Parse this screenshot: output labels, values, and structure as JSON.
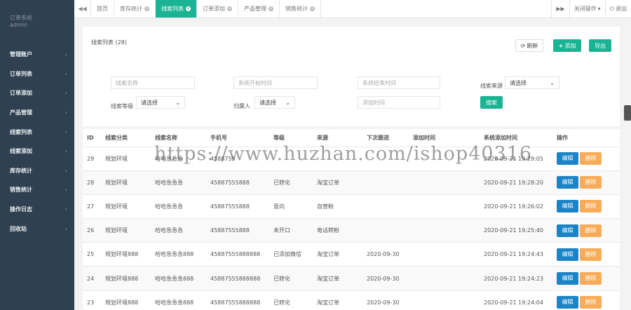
{
  "sidebar": {
    "brand_title": "订单系统",
    "brand_user": "admin",
    "items": [
      {
        "label": "管理账户"
      },
      {
        "label": "订单列表"
      },
      {
        "label": "订单添加"
      },
      {
        "label": "产品管理"
      },
      {
        "label": "线索列表"
      },
      {
        "label": "线索添加"
      },
      {
        "label": "库存统计"
      },
      {
        "label": "销售统计"
      },
      {
        "label": "操作日志"
      },
      {
        "label": "回收站"
      }
    ],
    "chevron": "‹"
  },
  "topbar": {
    "back_icon": "◀◀",
    "forward_icon": "▶▶",
    "tabs": [
      {
        "label": "首页",
        "closable": false
      },
      {
        "label": "库存统计",
        "closable": true
      },
      {
        "label": "线索列表",
        "closable": true,
        "active": true
      },
      {
        "label": "订单添加",
        "closable": true
      },
      {
        "label": "产品管理",
        "closable": true
      },
      {
        "label": "销售统计",
        "closable": true
      }
    ],
    "close_ops": "关闭操作",
    "logout": "退出"
  },
  "panel": {
    "title": "线索列表 (28)",
    "refresh": "刷新",
    "add": "添加",
    "export": "导出"
  },
  "filters": {
    "name_placeholder": "线索名称",
    "start_placeholder": "系统开始时间",
    "end_placeholder": "系统结束时间",
    "source_label": "线索来源",
    "source_value": "请选择",
    "level_label": "线索等级",
    "level_value": "请选择",
    "owner_label": "归属人",
    "owner_value": "请选择",
    "addtime_placeholder": "添加时间",
    "search": "搜索"
  },
  "table": {
    "headers": [
      "ID",
      "线索分类",
      "线索名称",
      "手机号",
      "等级",
      "来源",
      "下次跟进",
      "添加时间",
      "系统添加时间",
      "操作"
    ],
    "edit_label": "编辑",
    "delete_label": "删除",
    "rows": [
      {
        "id": "29",
        "cat": "规划环境",
        "name": "哈哈急急急",
        "phone": "4588755",
        "level": "",
        "source": "",
        "next": "",
        "added": "",
        "sys": "2020-09-21 19:29:05"
      },
      {
        "id": "28",
        "cat": "规划环境",
        "name": "哈哈急急急",
        "phone": "45887555888",
        "level": "已转化",
        "source": "淘宝订单",
        "next": "",
        "added": "",
        "sys": "2020-09-21 19:28:20"
      },
      {
        "id": "27",
        "cat": "规划环境",
        "name": "哈哈急急急",
        "phone": "45887555888",
        "level": "意向",
        "source": "自营粉",
        "next": "",
        "added": "",
        "sys": "2020-09-21 19:26:02"
      },
      {
        "id": "26",
        "cat": "规划环境",
        "name": "哈哈急急急",
        "phone": "45887555888",
        "level": "未开口",
        "source": "电话转粉",
        "next": "",
        "added": "",
        "sys": "2020-09-21 19:25:40"
      },
      {
        "id": "25",
        "cat": "规划环境888",
        "name": "哈哈急急急888",
        "phone": "45887555888888",
        "level": "已添加微信",
        "source": "淘宝订单",
        "next": "2020-09-30",
        "added": "",
        "sys": "2020-09-21 19:24:43"
      },
      {
        "id": "24",
        "cat": "规划环境888",
        "name": "哈哈急急急888",
        "phone": "45887555888888",
        "level": "已转化",
        "source": "淘宝订单",
        "next": "2020-09-30",
        "added": "",
        "sys": "2020-09-21 19:24:23"
      },
      {
        "id": "23",
        "cat": "规划环境888",
        "name": "哈哈急急急888",
        "phone": "45887555888888",
        "level": "已转化",
        "source": "淘宝订单",
        "next": "2020-09-30",
        "added": "",
        "sys": "2020-09-21 19:24:04"
      }
    ]
  },
  "watermark": "https://www.huzhan.com/ishop40316",
  "colors": {
    "sidebar": "#2f4050",
    "accent": "#1ab394",
    "edit": "#1c84c6",
    "delete": "#f8ac59"
  }
}
